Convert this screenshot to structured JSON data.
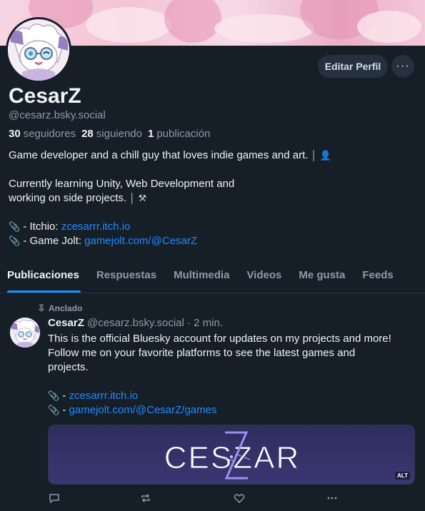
{
  "profile": {
    "display_name": "CesarZ",
    "handle": "@cesarz.bsky.social",
    "edit_label": "Editar Perfil",
    "more_label": "···",
    "stats": [
      {
        "value": "30",
        "label": "seguidores"
      },
      {
        "value": "28",
        "label": "siguiendo"
      },
      {
        "value": "1",
        "label": "publicación"
      }
    ],
    "bio": {
      "line1": "Game developer and a chill guy that loves indie games and art. ",
      "line2": "Currently learning Unity, Web Development and",
      "line3": "working on side projects. ",
      "link1_prefix": " - Itchio: ",
      "link1_text": "zcesarrr.itch.io",
      "link2_prefix": " - Game Jolt: ",
      "link2_text": "gamejolt.com/@CesarZ"
    }
  },
  "tabs": [
    "Publicaciones",
    "Respuestas",
    "Multimedia",
    "Videos",
    "Me gusta",
    "Feeds"
  ],
  "active_tab": "Publicaciones",
  "post": {
    "pinned_label": "Anclado",
    "author": "CesarZ",
    "meta": "@cesarz.bsky.social · 2 min.",
    "lines": [
      "This is the official Bluesky account for updates on my projects and more!",
      "Follow me on your favorite platforms to see the latest games and",
      "projects."
    ],
    "link1_text": "zcesarrr.itch.io",
    "link2_text": "gamejolt.com/@CesarZ/games",
    "embed_logo_text": "CESZAR",
    "alt_badge": "ALT"
  },
  "icons": {
    "more": "ellipsis-icon",
    "pin": "pin-icon",
    "paperclip": "paperclip-icon",
    "reply": "comment-icon",
    "repost": "repost-icon",
    "like": "heart-icon",
    "post_more": "ellipsis-icon"
  },
  "colors": {
    "background": "#161e27",
    "link": "#208bfe",
    "muted": "#8d9bab",
    "button": "#263140"
  }
}
